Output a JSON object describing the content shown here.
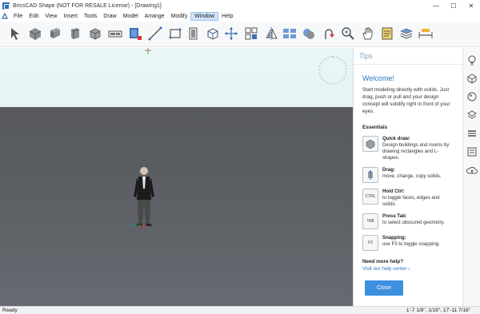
{
  "window": {
    "title": "BricsCAD Shape (NOT FOR RESALE License) - [Drawing1]",
    "minimize_glyph": "—",
    "maximize_glyph": "☐",
    "close_glyph": "✕"
  },
  "menu": {
    "items": [
      "File",
      "Edit",
      "View",
      "Insert",
      "Tools",
      "Draw",
      "Model",
      "Arrange",
      "Modify",
      "Window",
      "Help"
    ],
    "active": "Window"
  },
  "toolbar": {
    "icons": [
      "select-icon",
      "solid-box-icon",
      "polysolid-icon",
      "extrude-icon",
      "cube-icon",
      "window-icon",
      "material-icon",
      "line-icon",
      "rectangle-icon",
      "door-icon",
      "box-view-icon",
      "move-icon",
      "grid-icon",
      "mirror-icon",
      "array-icon",
      "union-icon",
      "push-pull-icon",
      "zoom-icon",
      "pan-hand-icon",
      "properties-icon",
      "layers-icon",
      "measure-icon"
    ]
  },
  "tips": {
    "header": "Tips",
    "welcome": "Welcome!",
    "intro": "Start modeling directly with solids. Just drag, push or pull and your design concept will solidify right in front of your eyes.",
    "essentials_label": "Essentials",
    "items": [
      {
        "icon_text": "",
        "title": "Quick draw:",
        "text": "Design buildings and rooms by drawing rectangles and L-shapes."
      },
      {
        "icon_text": "",
        "title": "Drag:",
        "text": "move, change, copy solids."
      },
      {
        "icon_text": "CTRL",
        "title": "Hold Ctrl:",
        "text": "to toggle faces, edges and solids."
      },
      {
        "icon_text": "TAB",
        "title": "Press Tab:",
        "text": "to select obscured geometry."
      },
      {
        "icon_text": "F3",
        "title": "Snapping:",
        "text": "use F3 to toggle snapping."
      }
    ],
    "help_title": "Need more help?",
    "help_link": "Visit our help center ›",
    "close_label": "Close"
  },
  "side_panel": {
    "icons": [
      "bulb-icon",
      "component-icon",
      "render-icon",
      "stack-icon",
      "layers-icon",
      "library-icon",
      "cloud-icon"
    ]
  },
  "status": {
    "left": "Ready",
    "coordinates": "1'-7 1/8\", 1/16\", 17'-11 7/16\""
  },
  "colors": {
    "accent": "#3d8fe0",
    "link": "#2a74c1",
    "ground": "#5b5e63",
    "sky": "#eaf7f7"
  }
}
